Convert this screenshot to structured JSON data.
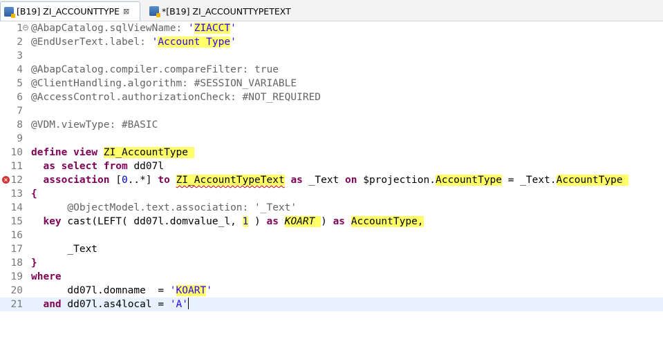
{
  "tabs": [
    {
      "label": "[B19] ZI_ACCOUNTTYPE",
      "active": true,
      "close": "⊠"
    },
    {
      "label": "*[B19] ZI_ACCOUNTTYPETEXT",
      "active": false
    }
  ],
  "editor": {
    "lines": [
      {
        "num": "1",
        "t": [
          "@AbapCatalog.sqlViewName: ",
          "'",
          "ZIACCT",
          "'"
        ]
      },
      {
        "num": "2",
        "t": [
          "@EndUserText.label: ",
          "'",
          "Account Type",
          "'"
        ]
      },
      {
        "num": "3"
      },
      {
        "num": "4",
        "t": [
          "@AbapCatalog.compiler.compareFilter: true"
        ]
      },
      {
        "num": "5",
        "t": [
          "@ClientHandling.algorithm: #SESSION_VARIABLE"
        ]
      },
      {
        "num": "6",
        "t": [
          "@AccessControl.authorizationCheck: #NOT_REQUIRED"
        ]
      },
      {
        "num": "7"
      },
      {
        "num": "8",
        "t": [
          "@VDM.viewType: #BASIC"
        ]
      },
      {
        "num": "9"
      },
      {
        "num": "10",
        "t": [
          "define",
          " ",
          "view",
          " ",
          "ZI_AccountType "
        ]
      },
      {
        "num": "11",
        "t": [
          "  ",
          "as",
          " ",
          "select",
          " ",
          "from",
          " dd07l"
        ]
      },
      {
        "num": "12",
        "t": [
          "  ",
          "association",
          " [",
          "0",
          "..*] ",
          "to",
          " ",
          "ZI_AccountTypeText",
          " ",
          "as",
          " _Text ",
          "on",
          " $projection.",
          "AccountType",
          " = _Text.",
          "AccountType "
        ]
      },
      {
        "num": "13",
        "t": [
          "{"
        ]
      },
      {
        "num": "14",
        "t": [
          "      @ObjectModel.text.association: '_Text'"
        ]
      },
      {
        "num": "15",
        "t": [
          "  ",
          "key",
          " cast(LEFT( dd07l.domvalue_l, ",
          "1",
          " ) ",
          "as",
          " ",
          "KOART ",
          ") ",
          "as",
          " ",
          "AccountType,"
        ]
      },
      {
        "num": "16"
      },
      {
        "num": "17",
        "t": [
          "      _Text"
        ]
      },
      {
        "num": "18",
        "t": [
          "}"
        ]
      },
      {
        "num": "19",
        "t": [
          "where"
        ]
      },
      {
        "num": "20",
        "t": [
          "      dd07l.domname  = ",
          "'",
          "KOART",
          "'"
        ]
      },
      {
        "num": "21",
        "t": [
          "  ",
          "and",
          " dd07l.as4local = ",
          "'A'"
        ]
      }
    ]
  }
}
